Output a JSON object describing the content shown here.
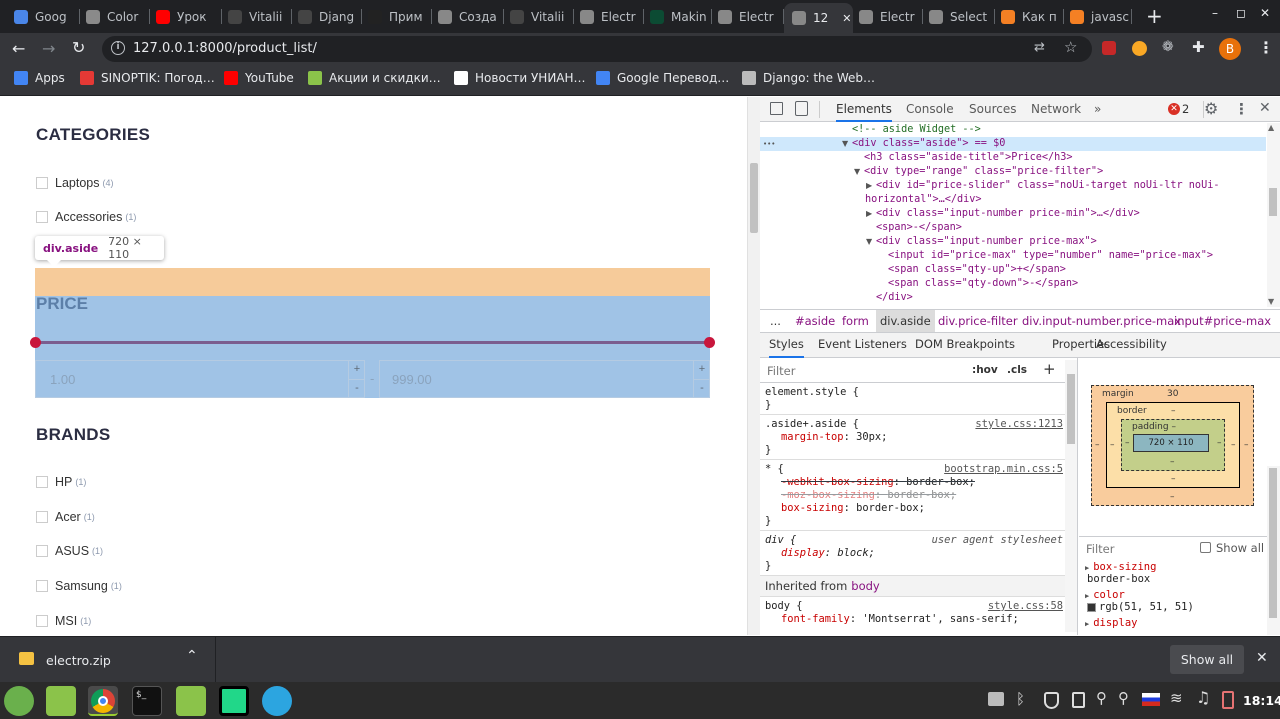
{
  "browser": {
    "tabs": [
      {
        "label": "Goog",
        "icon": "google-docs-icon",
        "color": "#4a86e8"
      },
      {
        "label": "Color",
        "icon": "wordpress-icon",
        "color": "#8a8a8a"
      },
      {
        "label": "Урок",
        "icon": "youtube-icon",
        "color": "#ff0000"
      },
      {
        "label": "Vitalii",
        "icon": "github-icon",
        "color": "#444"
      },
      {
        "label": "Djang",
        "icon": "github-icon",
        "color": "#444"
      },
      {
        "label": "Прим",
        "icon": "wave-icon",
        "color": "#222"
      },
      {
        "label": "Созда",
        "icon": "book-icon",
        "color": "#888"
      },
      {
        "label": "Vitalii",
        "icon": "github-icon",
        "color": "#444"
      },
      {
        "label": "Electr",
        "icon": "globe-icon",
        "color": "#888"
      },
      {
        "label": "Makin",
        "icon": "django-icon",
        "color": "#0c4b33"
      },
      {
        "label": "Electr",
        "icon": "globe-icon",
        "color": "#888"
      },
      {
        "label": "12",
        "icon": "globe-icon",
        "color": "#888",
        "active": true
      },
      {
        "label": "Electr",
        "icon": "globe-icon",
        "color": "#888"
      },
      {
        "label": "Select",
        "icon": "globe-icon",
        "color": "#888"
      },
      {
        "label": "Как п",
        "icon": "stackoverflow-icon",
        "color": "#f48024"
      },
      {
        "label": "javasc",
        "icon": "stackoverflow-icon",
        "color": "#f48024"
      }
    ],
    "active_tab_close": "✕",
    "new_tab": "+",
    "window_controls": {
      "minimize": "–",
      "maximize": "◻",
      "close": "✕"
    },
    "url": "127.0.0.1:8000/product_list/",
    "profile_initial": "B",
    "bookmarks": [
      {
        "label": "Apps",
        "icon": "apps-grid-icon",
        "color": "#4285f4"
      },
      {
        "label": "SINOPTIK: Погод…",
        "icon": "sinoptik-icon",
        "color": "#e53935"
      },
      {
        "label": "YouTube",
        "icon": "youtube-icon",
        "color": "#ff0000"
      },
      {
        "label": "Акции и скидки…",
        "icon": "sale-icon",
        "color": "#8bc34a"
      },
      {
        "label": "Новости УНИАН…",
        "icon": "news-icon",
        "color": "#ffffff"
      },
      {
        "label": "Google Перевод…",
        "icon": "translate-icon",
        "color": "#4285f4"
      },
      {
        "label": "Django: the Web…",
        "icon": "globe-icon",
        "color": "#bbbbbb"
      }
    ]
  },
  "page": {
    "categories_title": "CATEGORIES",
    "categories": [
      {
        "label": "Laptops",
        "count": "(4)"
      },
      {
        "label": "Accessories",
        "count": "(1)"
      }
    ],
    "tooltip": {
      "selector": "div.aside",
      "size": "720 × 110"
    },
    "price_title": "PRICE",
    "price_min": "1.00",
    "price_max": "999.00",
    "qty_up": "+",
    "qty_down": "-",
    "range_separator": "-",
    "brands_title": "BRANDS",
    "brands": [
      {
        "label": "HP",
        "count": "(1)"
      },
      {
        "label": "Acer",
        "count": "(1)"
      },
      {
        "label": "ASUS",
        "count": "(1)"
      },
      {
        "label": "Samsung",
        "count": "(1)"
      },
      {
        "label": "MSI",
        "count": "(1)"
      }
    ]
  },
  "devtools": {
    "tabs": [
      "Elements",
      "Console",
      "Sources",
      "Network",
      "»"
    ],
    "active_tab": "Elements",
    "error_count": "2",
    "dom_lines": [
      {
        "indent": 0,
        "html": "<!-- aside Widget -->",
        "comment": true
      },
      {
        "indent": 0,
        "html": "<div class=\"aside\"> == $0",
        "selected": true,
        "arrow": "▼"
      },
      {
        "indent": 1,
        "html": "<h3 class=\"aside-title\">Price</h3>"
      },
      {
        "indent": 1,
        "html": "<div type=\"range\" class=\"price-filter\">",
        "arrow": "▼"
      },
      {
        "indent": 2,
        "html": "<div id=\"price-slider\" class=\"noUi-target noUi-ltr noUi-",
        "arrow": "▶"
      },
      {
        "indent": -1,
        "html": "horizontal\">…</div>"
      },
      {
        "indent": 2,
        "html": "<div class=\"input-number price-min\">…</div>",
        "arrow": "▶"
      },
      {
        "indent": 2,
        "html": "<span>-</span>"
      },
      {
        "indent": 2,
        "html": "<div class=\"input-number price-max\">",
        "arrow": "▼"
      },
      {
        "indent": 3,
        "html": "<input id=\"price-max\" type=\"number\" name=\"price-max\">"
      },
      {
        "indent": 3,
        "html": "<span class=\"qty-up\">+</span>"
      },
      {
        "indent": 3,
        "html": "<span class=\"qty-down\">-</span>"
      },
      {
        "indent": 2,
        "html": "</div>"
      }
    ],
    "breadcrumbs": [
      "...",
      "#aside",
      "form",
      "div.aside",
      "div.price-filter",
      "div.input-number.price-max",
      "input#price-max"
    ],
    "active_breadcrumb": "div.aside",
    "subtabs": [
      "Styles",
      "Event Listeners",
      "DOM Breakpoints",
      "Properties",
      "Accessibility"
    ],
    "active_subtab": "Styles",
    "filter_placeholder": "Filter",
    "hov": ":hov",
    "cls": ".cls",
    "rules": [
      {
        "selector": "element.style {",
        "source": "",
        "props": []
      },
      {
        "selector": ".aside+.aside {",
        "source": "style.css:1213",
        "props": [
          {
            "name": "margin-top",
            "value": "30px;",
            "strike": false
          }
        ]
      },
      {
        "selector": "* {",
        "source": "bootstrap.min.css:5",
        "props": [
          {
            "name": "-webkit-box-sizing",
            "value": "border-box;",
            "strike": true
          },
          {
            "name": "-moz-box-sizing",
            "value": "border-box;",
            "strike": true,
            "faded": true
          },
          {
            "name": "box-sizing",
            "value": "border-box;",
            "strike": false
          }
        ]
      },
      {
        "selector": "div {",
        "source": "user agent stylesheet",
        "props": [
          {
            "name": "display",
            "value": "block;",
            "strike": false,
            "italic": true
          }
        ]
      }
    ],
    "inherited_label": "Inherited from",
    "inherited_from": "body",
    "body_rule": {
      "selector": "body {",
      "source": "style.css:58",
      "prop": "font-family",
      "value": "'Montserrat', sans-serif;"
    },
    "box_model": {
      "margin": "margin",
      "margin_top": "30",
      "border": "border",
      "padding": "padding",
      "content": "720 × 110",
      "dash": "–"
    },
    "computed_filter": "Filter",
    "show_all": "Show all",
    "computed": [
      {
        "name": "box-sizing",
        "value": "border-box"
      },
      {
        "name": "color",
        "value": "rgb(51, 51, 51)"
      },
      {
        "name": "display",
        "value": ""
      }
    ]
  },
  "download_bar": {
    "file": "electro.zip",
    "show_all": "Show all"
  },
  "taskbar": {
    "time": "18:14"
  }
}
